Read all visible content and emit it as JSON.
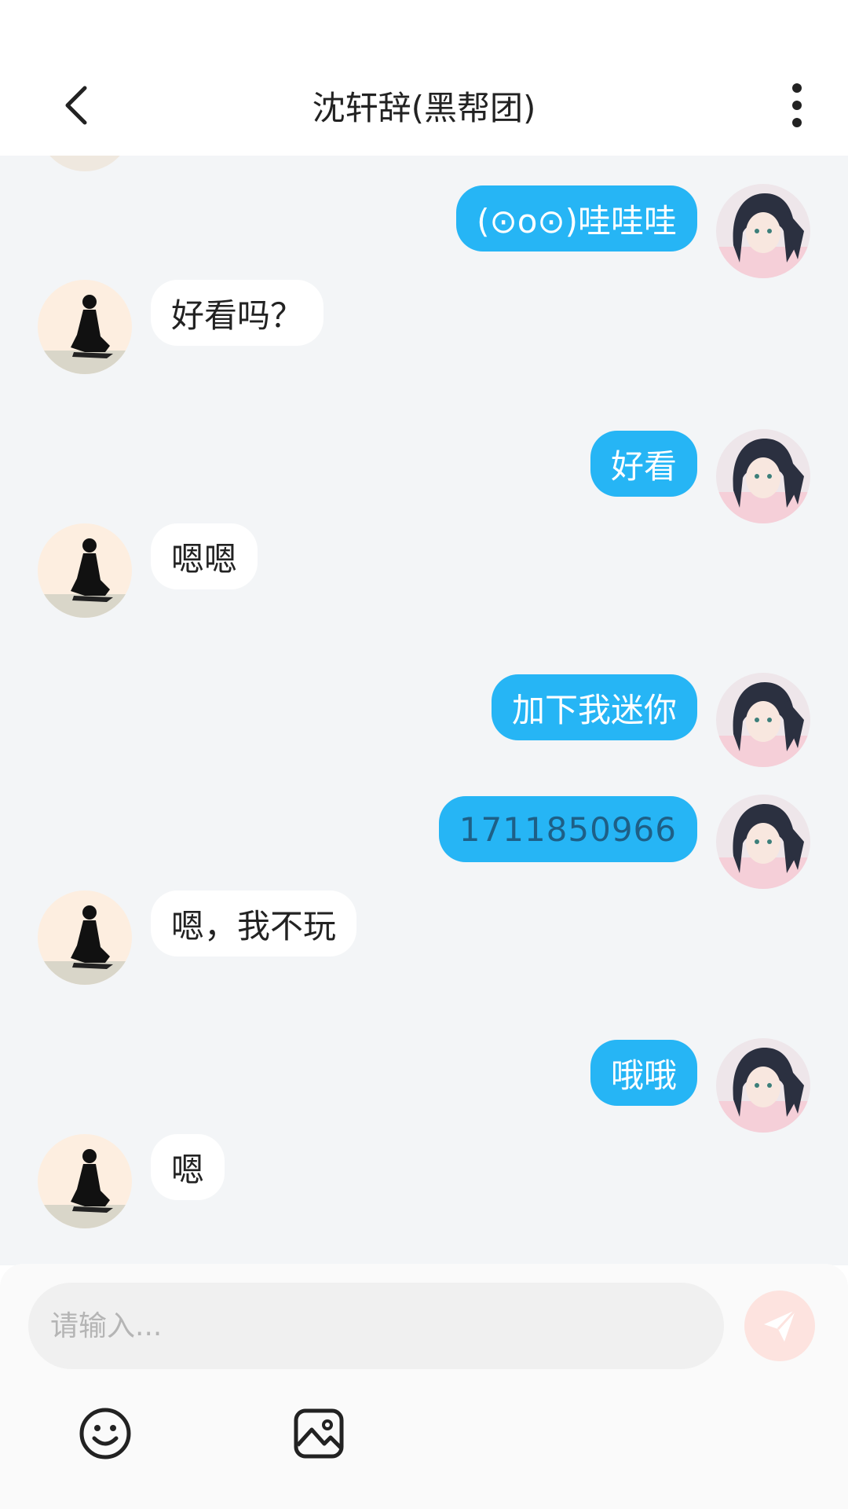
{
  "header": {
    "title": "沈轩辞(黑帮团)",
    "back_icon": "chevron-left-icon",
    "more_icon": "more-vertical-icon"
  },
  "messages": [
    {
      "side": "out",
      "text": "(⊙o⊙)哇哇哇"
    },
    {
      "side": "in",
      "text": "好看吗？"
    },
    {
      "side": "out",
      "text": "好看"
    },
    {
      "side": "in",
      "text": "嗯嗯"
    },
    {
      "side": "out",
      "text": "加下我迷你"
    },
    {
      "side": "out",
      "text": "1711850966"
    },
    {
      "side": "in",
      "text": "嗯，我不玩"
    },
    {
      "side": "out",
      "text": "哦哦"
    },
    {
      "side": "in",
      "text": "嗯"
    }
  ],
  "composer": {
    "placeholder": "请输入...",
    "send_icon": "send-icon",
    "emoji_icon": "emoji-icon",
    "image_icon": "image-icon"
  },
  "colors": {
    "outgoing_bubble": "#26b5f5",
    "incoming_bubble": "#ffffff",
    "chat_background": "#f3f5f7",
    "send_button": "#fde3df"
  }
}
